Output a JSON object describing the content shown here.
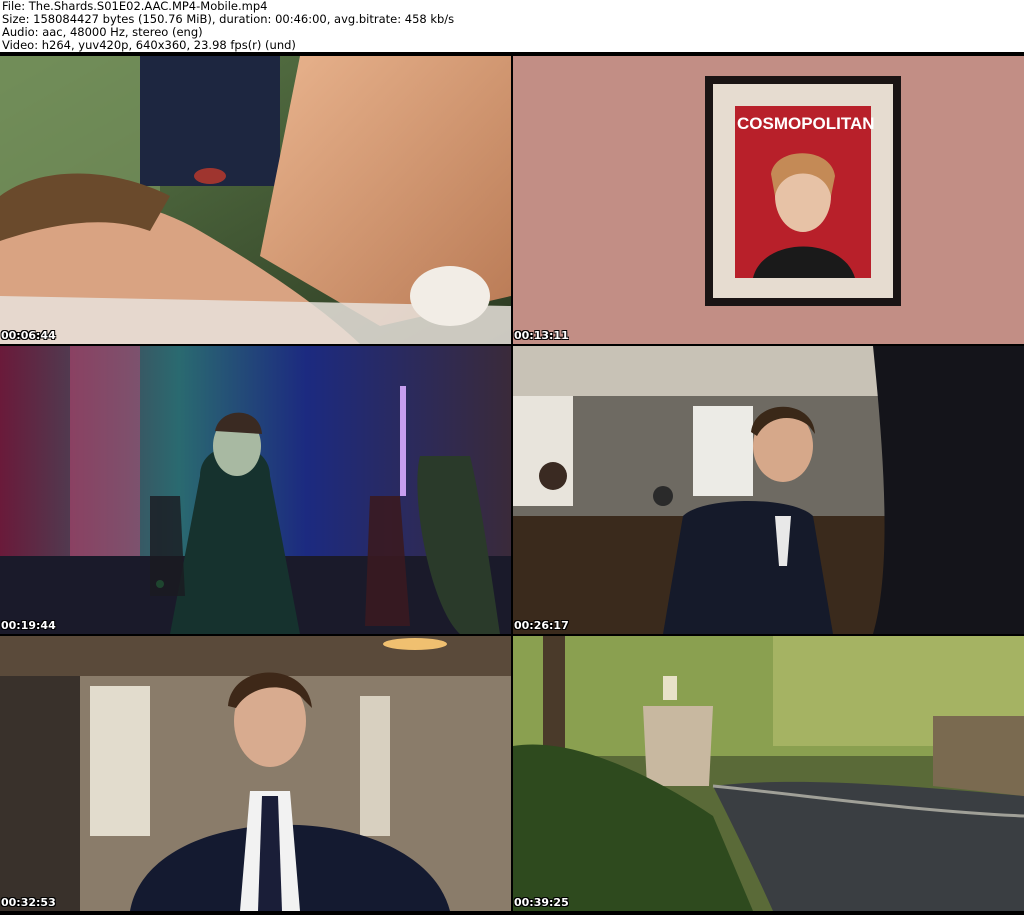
{
  "header": {
    "file_line": "File: The.Shards.S01E02.AAC.MP4-Mobile.mp4",
    "size_line": "Size: 158084427 bytes (150.76 MiB), duration: 00:46:00, avg.bitrate: 458 kb/s",
    "audio_line": "Audio: aac, 48000 Hz, stereo (eng)",
    "video_line": "Video: h264, yuv420p, 640x360, 23.98 fps(r) (und)"
  },
  "thumbnails": [
    {
      "timestamp": "00:06:44",
      "scene": "bed-closeup"
    },
    {
      "timestamp": "00:13:11",
      "scene": "framed-magazine",
      "magazine_title": "COSMOPOLITAN"
    },
    {
      "timestamp": "00:19:44",
      "scene": "neon-party"
    },
    {
      "timestamp": "00:26:17",
      "scene": "cafeteria-student"
    },
    {
      "timestamp": "00:32:53",
      "scene": "student-portrait"
    },
    {
      "timestamp": "00:39:25",
      "scene": "driveway-garden"
    }
  ],
  "colors": {
    "background": "#ffffff",
    "grid_gap": "#000000",
    "timestamp_text": "#ffffff",
    "magazine_red": "#b8202a"
  }
}
